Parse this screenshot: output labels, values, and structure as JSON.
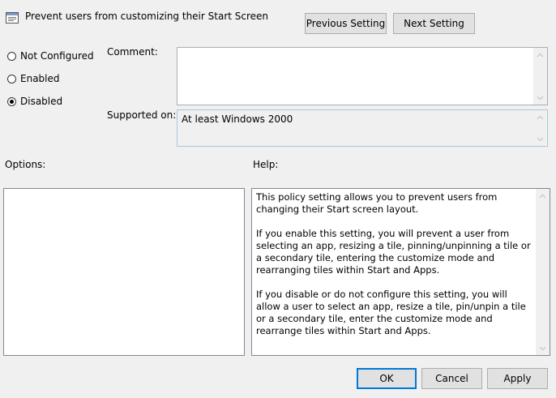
{
  "window": {
    "title": "Prevent users from customizing their Start Screen"
  },
  "nav": {
    "previous_label": "Previous Setting",
    "next_label": "Next Setting"
  },
  "state": {
    "not_configured_label": "Not Configured",
    "enabled_label": "Enabled",
    "disabled_label": "Disabled",
    "selected": "Disabled"
  },
  "comment": {
    "label": "Comment:",
    "value": ""
  },
  "supported_on": {
    "label": "Supported on:",
    "value": "At least Windows 2000"
  },
  "options": {
    "label": "Options:"
  },
  "help": {
    "label": "Help:",
    "paragraphs": [
      "This policy setting allows you to prevent users from changing their Start screen layout.",
      "If you enable this setting, you will prevent a user from selecting an app, resizing a tile, pinning/unpinning a tile or a secondary tile, entering the customize mode and rearranging tiles within Start and Apps.",
      "If you disable or do not configure this setting, you will allow a user to select an app, resize a tile, pin/unpin a tile or a secondary tile, enter the customize mode and rearrange tiles within Start and Apps."
    ]
  },
  "footer": {
    "ok_label": "OK",
    "cancel_label": "Cancel",
    "apply_label": "Apply"
  },
  "colors": {
    "dialog_bg": "#f0f0f0",
    "default_button_border": "#0078d7"
  },
  "icons": [
    "policy-setting-icon",
    "scroll-up-icon",
    "scroll-down-icon"
  ]
}
